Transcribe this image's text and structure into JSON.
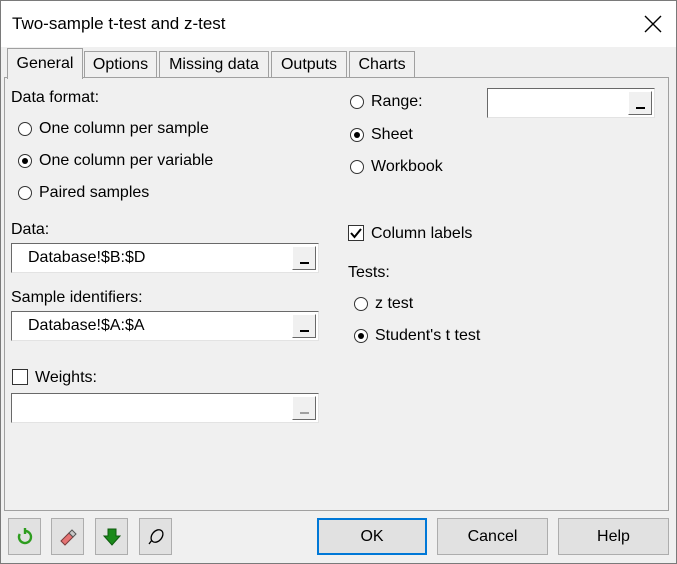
{
  "window": {
    "title": "Two-sample t-test and z-test"
  },
  "tabs": [
    {
      "label": "General"
    },
    {
      "label": "Options"
    },
    {
      "label": "Missing data"
    },
    {
      "label": "Outputs"
    },
    {
      "label": "Charts"
    }
  ],
  "data_format": {
    "label": "Data format:",
    "options": [
      {
        "label": "One column per sample",
        "selected": false
      },
      {
        "label": "One column per variable",
        "selected": true
      },
      {
        "label": "Paired samples",
        "selected": false
      }
    ]
  },
  "data": {
    "label": "Data:",
    "value": "Database!$B:$D"
  },
  "sample_identifiers": {
    "label": "Sample identifiers:",
    "value": "Database!$A:$A"
  },
  "weights": {
    "label": "Weights:",
    "checked": false,
    "value": ""
  },
  "output_location": {
    "options": [
      {
        "label": "Range:",
        "selected": false
      },
      {
        "label": "Sheet",
        "selected": true
      },
      {
        "label": "Workbook",
        "selected": false
      }
    ],
    "range_value": ""
  },
  "column_labels": {
    "label": "Column labels",
    "checked": true
  },
  "tests": {
    "label": "Tests:",
    "options": [
      {
        "label": "z test",
        "selected": false
      },
      {
        "label": "Student's t test",
        "selected": true
      }
    ]
  },
  "footer": {
    "ok_label": "OK",
    "cancel_label": "Cancel",
    "help_label": "Help"
  },
  "icons": {
    "reset": "refresh-icon",
    "clear": "eraser-icon",
    "down": "down-arrow-icon",
    "reference": "pin-icon"
  },
  "colors": {
    "accent": "#0078d7",
    "reset_icon": "#2e9d1f",
    "down_icon": "#1a8a1a"
  }
}
